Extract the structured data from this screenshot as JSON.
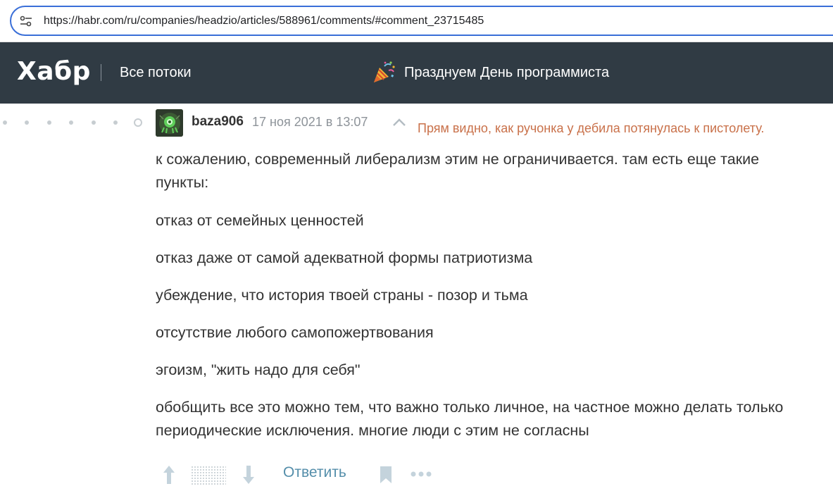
{
  "browser": {
    "url": "https://habr.com/ru/companies/headzio/articles/588961/comments/#comment_23715485",
    "site_info_icon": "tune-icon"
  },
  "header": {
    "logo": "Хабр",
    "nav_label": "Все потоки",
    "promo_text": "Празднуем День программиста",
    "promo_icon": "party-popper-icon",
    "background": "#303b44"
  },
  "comment": {
    "author": "baza906",
    "timestamp": "17 ноя 2021 в 13:07",
    "annotation": "Прям видно, как ручонка у дебила потянулась к пистолету.",
    "annotation_color": "#c9714a",
    "paragraphs": [
      "к сожалению, современный либерализм этим не ограничивается. там есть еще такие пункты:",
      "отказ от семейных ценностей",
      "отказ даже от самой адекватной формы патриотизма",
      "убеждение, что история твоей страны - позор и тьма",
      "отсутствие любого самопожертвования",
      "эгоизм, \"жить надо для себя\"",
      "обобщить все это можно тем, что важно только личное, на частное можно делать только периодические исключения. многие люди с этим не согласны"
    ]
  },
  "actions": {
    "reply_label": "Ответить",
    "reply_color": "#548eaa",
    "icons": [
      "arrow-up-icon",
      "rating-hidden-icon",
      "arrow-down-icon",
      "bookmark-icon",
      "more-icon"
    ]
  }
}
